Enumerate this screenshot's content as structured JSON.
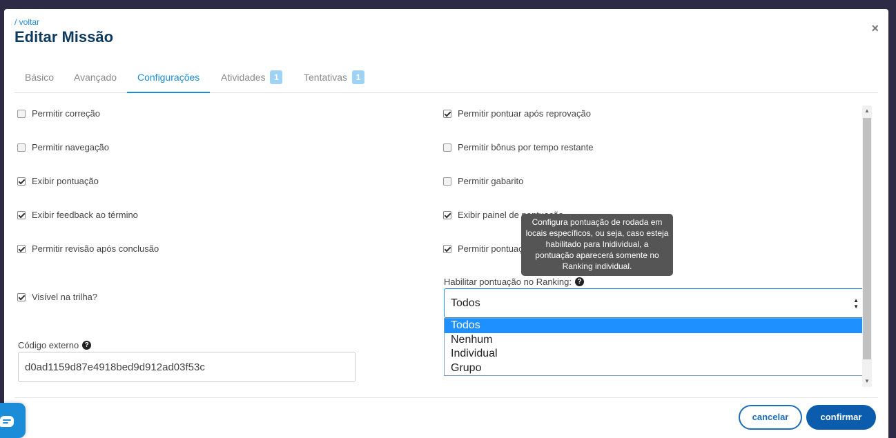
{
  "header": {
    "back_link": "/ voltar",
    "title": "Editar Missão",
    "close_symbol": "×"
  },
  "tabs": [
    {
      "label": "Básico",
      "active": false
    },
    {
      "label": "Avançado",
      "active": false
    },
    {
      "label": "Configurações",
      "active": true
    },
    {
      "label": "Atividades",
      "badge": "1",
      "active": false
    },
    {
      "label": "Tentativas",
      "badge": "1",
      "active": false
    }
  ],
  "left_options": [
    {
      "label": "Permitir correção",
      "checked": false
    },
    {
      "label": "Permitir navegação",
      "checked": false
    },
    {
      "label": "Exibir pontuação",
      "checked": true
    },
    {
      "label": "Exibir feedback ao término",
      "checked": true
    },
    {
      "label": "Permitir revisão após conclusão",
      "checked": true
    },
    {
      "label": "Visível na trilha?",
      "checked": true
    }
  ],
  "right_options": [
    {
      "label": "Permitir pontuar após reprovação",
      "checked": true
    },
    {
      "label": "Permitir bônus por tempo restante",
      "checked": false
    },
    {
      "label": "Permitir gabarito",
      "checked": false
    },
    {
      "label": "Exibir painel de pontuação",
      "checked": true
    },
    {
      "label": "Permitir pontuação",
      "checked": true
    }
  ],
  "external_code": {
    "label": "Código externo",
    "value": "d0ad1159d87e4918bed9d912ad03f53c"
  },
  "ranking": {
    "label": "Habilitar pontuação no Ranking:",
    "selected": "Todos",
    "options": [
      "Todos",
      "Nenhum",
      "Individual",
      "Grupo"
    ]
  },
  "tooltip": {
    "text": "Configura pontuação de rodada em locais específicos, ou seja, caso esteja habilitado para Inidividual, a pontuação aparecerá somente no Ranking individual."
  },
  "footer": {
    "cancel_label": "cancelar",
    "confirm_label": "confirmar"
  },
  "colors": {
    "accent": "#1a8cd8",
    "title": "#0e3a5e",
    "confirm": "#0b5cad",
    "tooltip_bg": "#555555"
  },
  "icons": {
    "close": "close-icon",
    "help": "help-icon",
    "select_arrows": "select-arrows-icon",
    "chat": "chat-icon"
  }
}
